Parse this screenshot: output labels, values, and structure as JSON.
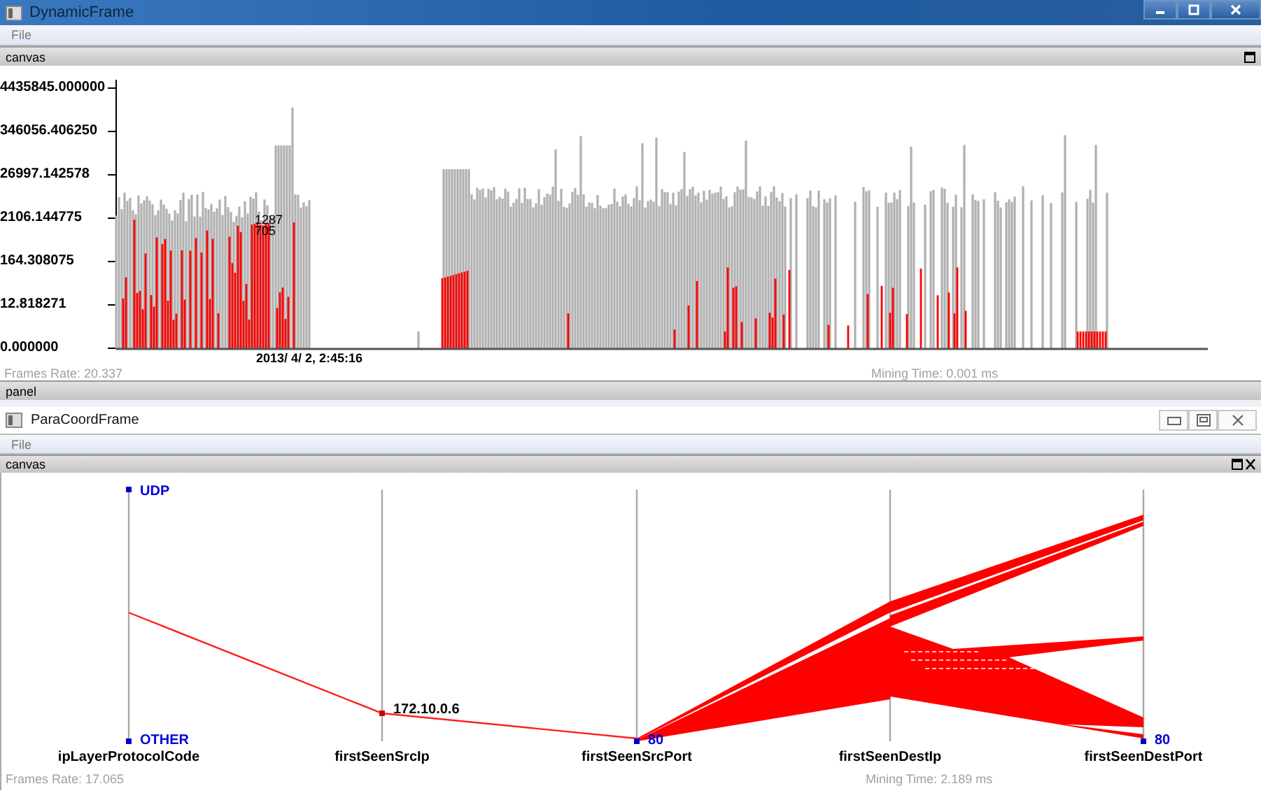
{
  "dynamic_frame": {
    "title": "DynamicFrame",
    "menu": [
      "File"
    ],
    "canvas_panel": {
      "title": "canvas"
    },
    "histogram": {
      "y_tick_labels": [
        "4435845.000000",
        "346056.406250",
        "26997.142578",
        "2106.144775",
        "164.308075",
        "12.818271",
        "0.000000"
      ],
      "annotations": [
        "1287",
        "705"
      ],
      "time_label": "2013/ 4/ 2, 2:45:16"
    },
    "status": {
      "frame_rate": "Frames Rate: 20.337",
      "mining_time": "Mining Time: 0.001 ms"
    },
    "panel": {
      "title": "panel"
    }
  },
  "para_coord_frame": {
    "title": "ParaCoordFrame",
    "menu": [
      "File"
    ],
    "canvas_panel": {
      "title": "canvas"
    },
    "axes": [
      {
        "name": "ipLayerProtocolCode",
        "labels": [
          {
            "text": "UDP",
            "kind": "top"
          },
          {
            "text": "OTHER",
            "kind": "bottom"
          }
        ]
      },
      {
        "name": "firstSeenSrcIp",
        "labels": [
          {
            "text": "172.10.0.6",
            "kind": "point"
          }
        ]
      },
      {
        "name": "firstSeenSrcPort",
        "labels": [
          {
            "text": "80",
            "kind": "bottom"
          }
        ]
      },
      {
        "name": "firstSeenDestIp"
      },
      {
        "name": "firstSeenDestPort",
        "labels": [
          {
            "text": "80",
            "kind": "bottom"
          }
        ]
      }
    ],
    "status": {
      "frame_rate": "Frames Rate: 17.065",
      "mining_time": "Mining Time: 2.189 ms"
    }
  }
}
